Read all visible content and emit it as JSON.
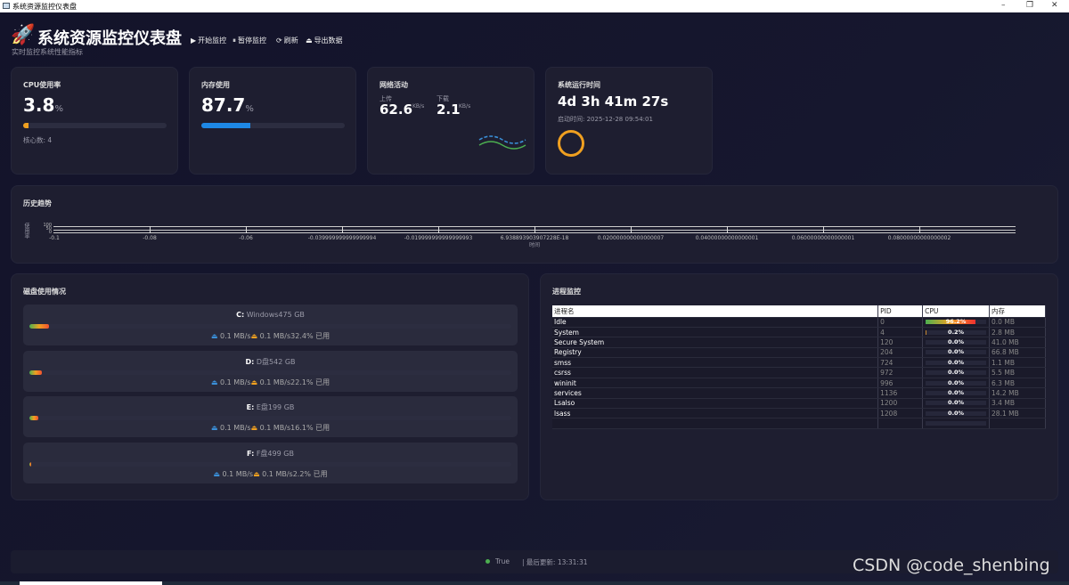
{
  "window": {
    "title": "系统资源监控仪表盘",
    "minimize": "–",
    "maximize": "❐",
    "close": "✕"
  },
  "header": {
    "title": "系统资源监控仪表盘",
    "subtitle": "实时监控系统性能指标",
    "buttons": [
      {
        "icon": "play-icon",
        "glyph": "▶",
        "label": "开始监控"
      },
      {
        "icon": "pause-icon",
        "glyph": "⏸",
        "label": "暂停监控"
      },
      {
        "icon": "refresh-icon",
        "glyph": "⟳",
        "label": "刷新"
      },
      {
        "icon": "export-icon",
        "glyph": "⏏",
        "label": "导出数据"
      }
    ]
  },
  "cpu": {
    "label": "CPU使用率",
    "value": "3.8",
    "unit": "%",
    "percent": 3.8,
    "cores": "核心数: 4",
    "color": "#f0a020"
  },
  "memory": {
    "label": "内存使用",
    "value": "87.7",
    "unit": "%",
    "percent": 34,
    "color": "#1e88e5"
  },
  "network": {
    "label": "网络活动",
    "upload_label": "上传",
    "upload": "62.6",
    "download_label": "下载",
    "download": "2.1",
    "unit": "KB/s"
  },
  "uptime": {
    "label": "系统运行时间",
    "value": "4d 3h 41m 27s",
    "boot": "启动时间: 2025-12-28 09:54:01"
  },
  "history": {
    "title": "历史趋势",
    "ylabel": "使用率",
    "yticks": [
      "100",
      "50",
      "0"
    ],
    "xlabel": "时间",
    "xticks": [
      "-0.1",
      "-0.08",
      "-0.06",
      "-0.039999999999999994",
      "-0.019999999999999993",
      "6.938893903907228E-18",
      "0.020000000000000007",
      "0.04000000000000001",
      "0.06000000000000001",
      "0.08000000000000002"
    ]
  },
  "disks": {
    "title": "磁盘使用情况",
    "items": [
      {
        "drive": "C:",
        "name": "Windows475 GB",
        "read": "0.1 MB/s",
        "write": "0.1 MB/s",
        "used": "32.4% 已用",
        "fill": 4
      },
      {
        "drive": "D:",
        "name": "D盘542 GB",
        "read": "0.1 MB/s",
        "write": "0.1 MB/s",
        "used": "22.1% 已用",
        "fill": 2.6
      },
      {
        "drive": "E:",
        "name": "E盘199 GB",
        "read": "0.1 MB/s",
        "write": "0.1 MB/s",
        "used": "16.1% 已用",
        "fill": 1.9
      },
      {
        "drive": "F:",
        "name": "F盘499 GB",
        "read": "0.1 MB/s",
        "write": "0.1 MB/s",
        "used": "2.2% 已用",
        "fill": 0.3
      }
    ]
  },
  "processes": {
    "title": "进程监控",
    "columns": [
      "进程名",
      "PID",
      "CPU",
      "内存"
    ],
    "rows": [
      {
        "name": "Idle",
        "pid": "0",
        "cpu": "96.2%",
        "cpu_pct": 96.2,
        "mem": "0.0 MB"
      },
      {
        "name": "System",
        "pid": "4",
        "cpu": "0.2%",
        "cpu_pct": 0.2,
        "mem": "2.8 MB"
      },
      {
        "name": "Secure System",
        "pid": "120",
        "cpu": "0.0%",
        "cpu_pct": 0,
        "mem": "41.0 MB"
      },
      {
        "name": "Registry",
        "pid": "204",
        "cpu": "0.0%",
        "cpu_pct": 0,
        "mem": "66.8 MB"
      },
      {
        "name": "smss",
        "pid": "724",
        "cpu": "0.0%",
        "cpu_pct": 0,
        "mem": "1.1 MB"
      },
      {
        "name": "csrss",
        "pid": "972",
        "cpu": "0.0%",
        "cpu_pct": 0,
        "mem": "5.5 MB"
      },
      {
        "name": "wininit",
        "pid": "996",
        "cpu": "0.0%",
        "cpu_pct": 0,
        "mem": "6.3 MB"
      },
      {
        "name": "services",
        "pid": "1136",
        "cpu": "0.0%",
        "cpu_pct": 0,
        "mem": "14.2 MB"
      },
      {
        "name": "Lsalso",
        "pid": "1200",
        "cpu": "0.0%",
        "cpu_pct": 0,
        "mem": "3.4 MB"
      },
      {
        "name": "lsass",
        "pid": "1208",
        "cpu": "0.0%",
        "cpu_pct": 0,
        "mem": "28.1 MB"
      }
    ]
  },
  "status": {
    "state": "True",
    "updated": "| 最后更新: 13:31:31",
    "dot_color": "#4caf50"
  },
  "watermark": "CSDN @code_shenbing"
}
